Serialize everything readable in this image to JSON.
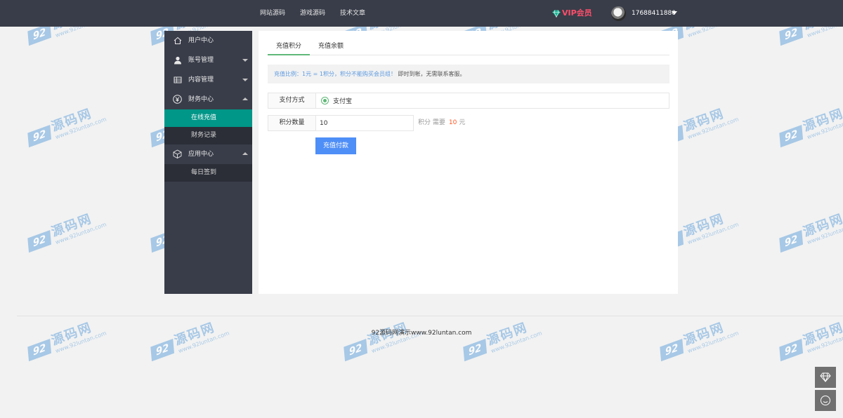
{
  "topbar": {
    "nav": [
      "网站源码",
      "游戏源码",
      "技术文章"
    ],
    "vip_label": "VIP会员",
    "username": "17688411880"
  },
  "sidebar": {
    "items": [
      {
        "label": "用户中心",
        "icon": "home-icon"
      },
      {
        "label": "账号管理",
        "icon": "user-icon"
      },
      {
        "label": "内容管理",
        "icon": "grid-icon"
      },
      {
        "label": "财务中心",
        "icon": "yen-icon"
      },
      {
        "label": "应用中心",
        "icon": "cube-icon"
      }
    ],
    "finance_sub": [
      "在线充值",
      "财务记录"
    ],
    "app_sub": [
      "每日签到"
    ]
  },
  "panel": {
    "tabs": [
      "充值积分",
      "充值余额"
    ],
    "notice_highlight": "充值比例：1元 = 1积分，积分不能购买会员组！",
    "notice_rest": "即时到帐，无需联系客服。",
    "payment_label": "支付方式",
    "payment_option": "支付宝",
    "points_label": "积分数量",
    "points_value": "10",
    "unit_points": "积分",
    "need_label": "需要",
    "price": "10",
    "price_unit": "元",
    "submit": "充值付款"
  },
  "footer": {
    "copyright": "92源码网演示www.92luntan.com"
  },
  "watermark": {
    "badge": "92",
    "cn": "源码网",
    "en": "www.92luntan.com"
  },
  "colors": {
    "topbar": "#393d49",
    "active_sub": "#009688",
    "tab_underline": "#5fb878",
    "button": "#4e8ef7",
    "vip": "#ff4e6a",
    "price": "#ff5722"
  }
}
